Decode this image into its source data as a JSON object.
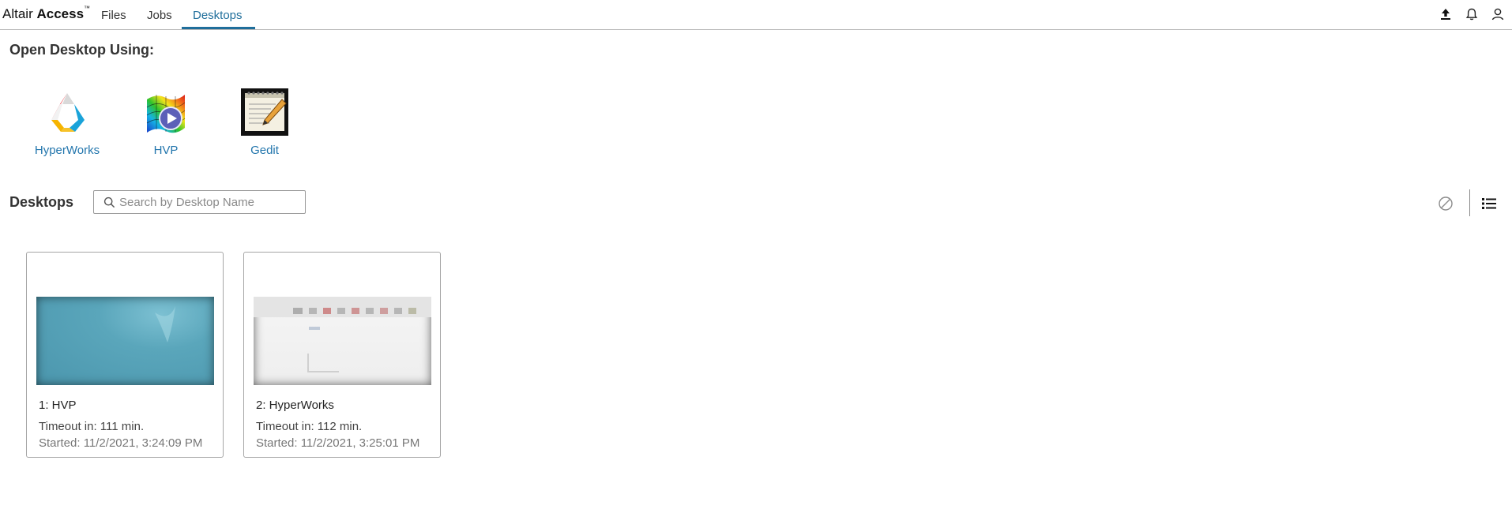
{
  "app": {
    "brand_primary": "Altair",
    "brand_secondary": "Access",
    "brand_mark": "™"
  },
  "nav": {
    "tabs": [
      {
        "label": "Files",
        "active": false
      },
      {
        "label": "Jobs",
        "active": false
      },
      {
        "label": "Desktops",
        "active": true
      }
    ],
    "icons": [
      "upload-icon",
      "bell-icon",
      "user-icon"
    ]
  },
  "open_desktop": {
    "title": "Open Desktop Using:",
    "apps": [
      {
        "label": "HyperWorks",
        "icon": "hyperworks-icon"
      },
      {
        "label": "HVP",
        "icon": "hvp-icon"
      },
      {
        "label": "Gedit",
        "icon": "gedit-icon"
      }
    ]
  },
  "desktops": {
    "title": "Desktops",
    "search_placeholder": "Search by Desktop Name",
    "search_value": "",
    "toolbar_icons": [
      "terminate-icon",
      "list-view-icon"
    ],
    "cards": [
      {
        "name": "1: HVP",
        "timeout": "Timeout in: 111 min.",
        "started": "Started: 11/2/2021, 3:24:09 PM"
      },
      {
        "name": "2: HyperWorks",
        "timeout": "Timeout in: 112 min.",
        "started": "Started: 11/2/2021, 3:25:01 PM"
      }
    ]
  },
  "colors": {
    "accent": "#1f6e9b",
    "link": "#2376ad",
    "border": "#a6a6a6"
  }
}
